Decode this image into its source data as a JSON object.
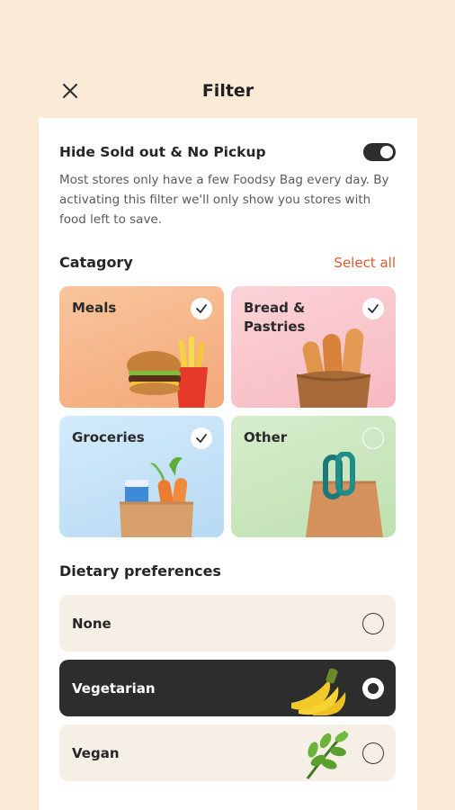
{
  "header": {
    "title": "Filter",
    "close_icon": "close-icon"
  },
  "availability": {
    "label": "Hide Sold out & No Pickup",
    "enabled": true,
    "description": "Most stores only have a few Foodsy Bag every day. By activating this filter we'll only show you stores with food left to save."
  },
  "category": {
    "title": "Catagory",
    "select_all": "Select all",
    "items": [
      {
        "label": "Meals",
        "checked": true,
        "color": "#f8b98a",
        "icon": "burger-fries-icon"
      },
      {
        "label": "Bread & Pastries",
        "checked": true,
        "color": "#f9c8cf",
        "icon": "bread-basket-icon"
      },
      {
        "label": "Groceries",
        "checked": true,
        "color": "#c6e2f6",
        "icon": "grocery-bag-icon"
      },
      {
        "label": "Other",
        "checked": false,
        "color": "#cfe8c4",
        "icon": "shopping-bag-icon"
      }
    ]
  },
  "dietary": {
    "title": "Dietary preferences",
    "options": [
      {
        "label": "None",
        "selected": false,
        "icon": ""
      },
      {
        "label": "Vegetarian",
        "selected": true,
        "icon": "banana-icon"
      },
      {
        "label": "Vegan",
        "selected": false,
        "icon": "leaf-icon"
      }
    ]
  },
  "colors": {
    "accent": "#e2572f",
    "dark": "#2d2d2d",
    "background": "#fbead6"
  }
}
